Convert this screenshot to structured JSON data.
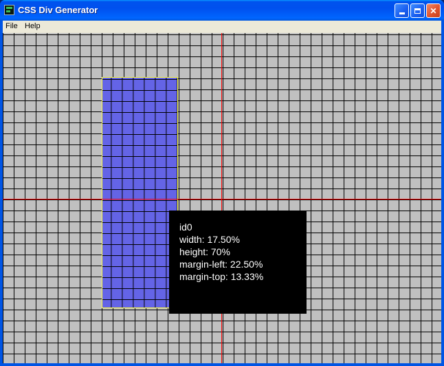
{
  "window": {
    "title": "CSS Div Generator"
  },
  "menu": {
    "items": [
      "File",
      "Help"
    ]
  },
  "titlebar_buttons": {
    "minimize": "minimize-icon",
    "maximize": "maximize-icon",
    "close_glyph": "✕"
  },
  "selected_div": {
    "id": "id0",
    "width": "width: 17.50%",
    "height": "height: 70%",
    "margin_left": "margin-left: 22.50%",
    "margin_top": "margin-top: 13.33%"
  },
  "colors": {
    "grid_background": "#c0c0c0",
    "grid_lines": "#000000",
    "div_fill": "#6464e6",
    "div_border": "#ffff40",
    "crosshair": "#ff0000",
    "tooltip_background": "#000000",
    "tooltip_text": "#ffffff"
  }
}
